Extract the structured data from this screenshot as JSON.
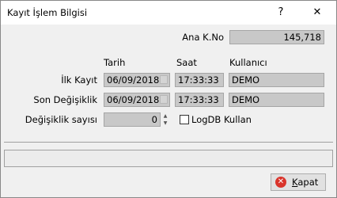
{
  "window": {
    "title": "Kayıt İşlem Bilgisi",
    "help_glyph": "?",
    "close_glyph": "✕"
  },
  "ana_kno": {
    "label": "Ana K.No",
    "value": "145,718"
  },
  "columns": {
    "tarih": "Tarih",
    "saat": "Saat",
    "kullanici": "Kullanıcı"
  },
  "rows": [
    {
      "label": "İlk Kayıt",
      "date": "06/09/2018",
      "time": "17:33:33",
      "user": "DEMO"
    },
    {
      "label": "Son Değişiklik",
      "date": "06/09/2018",
      "time": "17:33:33",
      "user": "DEMO"
    }
  ],
  "change_count": {
    "label": "Değişiklik sayısı",
    "value": "0"
  },
  "logdb": {
    "label": "LogDB Kullan",
    "checked": false
  },
  "status_text": "",
  "close_button": {
    "label_first": "K",
    "label_rest": "apat"
  }
}
